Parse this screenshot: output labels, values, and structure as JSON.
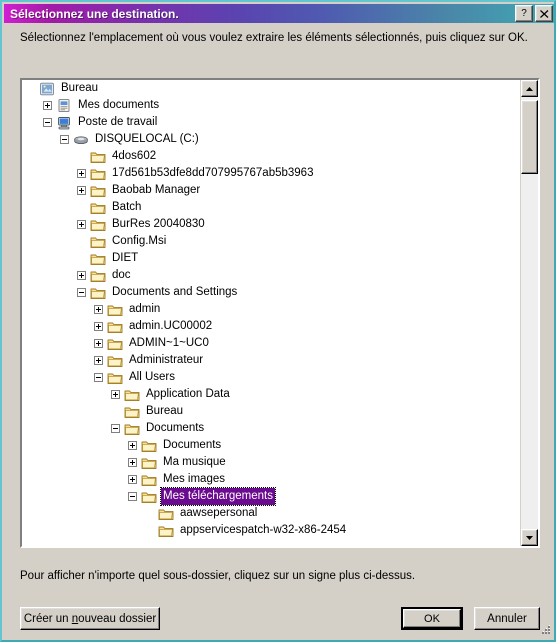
{
  "window": {
    "title": "Sélectionnez une destination.",
    "help_button": "?",
    "close_button": "✕",
    "accent_title_start": "#d11fd1",
    "accent_title_end": "#3fa9b5",
    "selection_color": "#6b0b8f",
    "face_color": "#d4d0c8"
  },
  "prompt": "Sélectionnez l'emplacement où vous voulez extraire les éléments sélectionnés, puis cliquez sur OK.",
  "hint": "Pour afficher n'importe quel sous-dossier, cliquez sur un signe plus ci-dessus.",
  "buttons": {
    "new_folder_pre": "Créer un ",
    "new_folder_accel": "n",
    "new_folder_post": "ouveau dossier",
    "ok": "OK",
    "cancel": "Annuler"
  },
  "scrollbar": {
    "up_arrow": "up-arrow-icon",
    "down_arrow": "down-arrow-icon"
  },
  "tree": [
    {
      "label": "Bureau",
      "depth": 0,
      "icon": "desktop",
      "expander": "none"
    },
    {
      "label": "Mes documents",
      "depth": 1,
      "icon": "mydocs",
      "expander": "plus"
    },
    {
      "label": "Poste de travail",
      "depth": 1,
      "icon": "computer",
      "expander": "minus"
    },
    {
      "label": "DISQUELOCAL (C:)",
      "depth": 2,
      "icon": "drive",
      "expander": "minus"
    },
    {
      "label": "4dos602",
      "depth": 3,
      "icon": "folder",
      "expander": "none"
    },
    {
      "label": "17d561b53dfe8dd707995767ab5b3963",
      "depth": 3,
      "icon": "folder",
      "expander": "plus"
    },
    {
      "label": "Baobab Manager",
      "depth": 3,
      "icon": "folder",
      "expander": "plus"
    },
    {
      "label": "Batch",
      "depth": 3,
      "icon": "folder",
      "expander": "none"
    },
    {
      "label": "BurRes 20040830",
      "depth": 3,
      "icon": "folder",
      "expander": "plus"
    },
    {
      "label": "Config.Msi",
      "depth": 3,
      "icon": "folder",
      "expander": "none"
    },
    {
      "label": "DIET",
      "depth": 3,
      "icon": "folder",
      "expander": "none"
    },
    {
      "label": "doc",
      "depth": 3,
      "icon": "folder",
      "expander": "plus"
    },
    {
      "label": "Documents and Settings",
      "depth": 3,
      "icon": "folder",
      "expander": "minus"
    },
    {
      "label": "admin",
      "depth": 4,
      "icon": "folder",
      "expander": "plus"
    },
    {
      "label": "admin.UC00002",
      "depth": 4,
      "icon": "folder",
      "expander": "plus"
    },
    {
      "label": "ADMIN~1~UC0",
      "depth": 4,
      "icon": "folder",
      "expander": "plus"
    },
    {
      "label": "Administrateur",
      "depth": 4,
      "icon": "folder",
      "expander": "plus"
    },
    {
      "label": "All Users",
      "depth": 4,
      "icon": "folder",
      "expander": "minus"
    },
    {
      "label": "Application Data",
      "depth": 5,
      "icon": "folder",
      "expander": "plus"
    },
    {
      "label": "Bureau",
      "depth": 5,
      "icon": "folder",
      "expander": "none"
    },
    {
      "label": "Documents",
      "depth": 5,
      "icon": "folder",
      "expander": "minus"
    },
    {
      "label": "Documents",
      "depth": 6,
      "icon": "folder",
      "expander": "plus"
    },
    {
      "label": "Ma musique",
      "depth": 6,
      "icon": "folder",
      "expander": "plus"
    },
    {
      "label": "Mes images",
      "depth": 6,
      "icon": "folder",
      "expander": "plus"
    },
    {
      "label": "Mes téléchargements",
      "depth": 6,
      "icon": "folder",
      "expander": "minus",
      "selected": true
    },
    {
      "label": "aawsepersonal",
      "depth": 7,
      "icon": "folder",
      "expander": "none"
    },
    {
      "label": "appservicespatch-w32-x86-2454",
      "depth": 7,
      "icon": "folder",
      "expander": "none"
    }
  ]
}
